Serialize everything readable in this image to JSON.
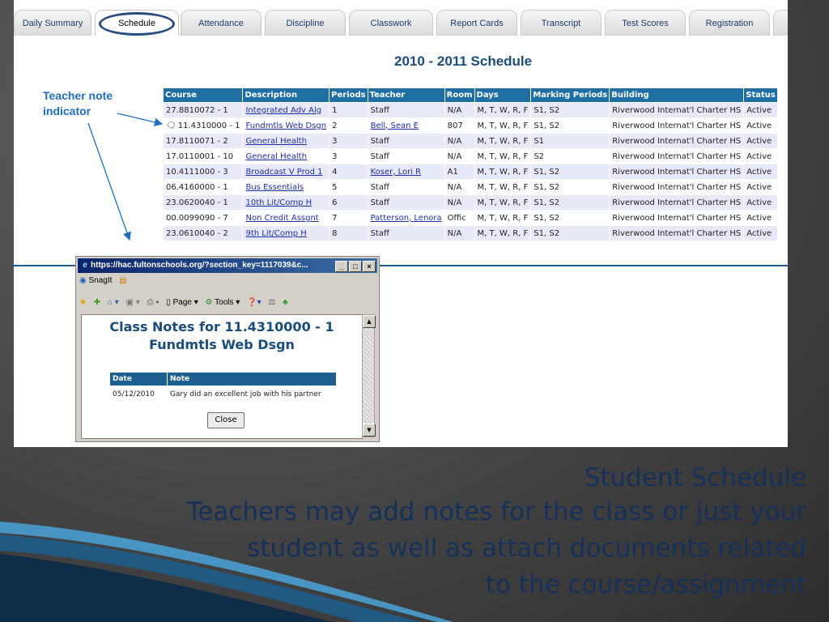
{
  "tabs": [
    "Daily Summary",
    "Schedule",
    "Attendance",
    "Discipline",
    "Classwork",
    "Report Cards",
    "Transcript",
    "Test Scores",
    "Registration"
  ],
  "active_tab": "Schedule",
  "schedule_title": "2010 - 2011 Schedule",
  "annotation_label": "Teacher note indicator",
  "table": {
    "headers": [
      "Course",
      "Description",
      "Periods",
      "Teacher",
      "Room",
      "Days",
      "Marking Periods",
      "Building",
      "Status"
    ],
    "rows": [
      [
        "27.8810072 - 1",
        "Integrated Adv Alg",
        "1",
        "Staff",
        "N/A",
        "M, T, W, R, F",
        "S1, S2",
        "Riverwood Internat'l Charter HS",
        "Active"
      ],
      [
        "11.4310000 - 1",
        "Fundmtls Web Dsgn",
        "2",
        "Bell, Sean E",
        "807",
        "M, T, W, R, F",
        "S1, S2",
        "Riverwood Internat'l Charter HS",
        "Active"
      ],
      [
        "17.8110071 - 2",
        "General Health",
        "3",
        "Staff",
        "N/A",
        "M, T, W, R, F",
        "S1",
        "Riverwood Internat'l Charter HS",
        "Active"
      ],
      [
        "17.0110001 - 10",
        "General Health",
        "3",
        "Staff",
        "N/A",
        "M, T, W, R, F",
        "S2",
        "Riverwood Internat'l Charter HS",
        "Active"
      ],
      [
        "10.4111000 - 3",
        "Broadcast V Prod 1",
        "4",
        "Koser, Lori R",
        "A1",
        "M, T, W, R, F",
        "S1, S2",
        "Riverwood Internat'l Charter HS",
        "Active"
      ],
      [
        "06.4160000 - 1",
        "Bus Essentials",
        "5",
        "Staff",
        "N/A",
        "M, T, W, R, F",
        "S1, S2",
        "Riverwood Internat'l Charter HS",
        "Active"
      ],
      [
        "23.0620040 - 1",
        "10th Lit/Comp H",
        "6",
        "Staff",
        "N/A",
        "M, T, W, R, F",
        "S1, S2",
        "Riverwood Internat'l Charter HS",
        "Active"
      ],
      [
        "00.0099090 - 7",
        "Non Credit Assgnt",
        "7",
        "Patterson, Lenora",
        "Offic",
        "M, T, W, R, F",
        "S1, S2",
        "Riverwood Internat'l Charter HS",
        "Active"
      ],
      [
        "23.0610040 - 2",
        "9th Lit/Comp H",
        "8",
        "Staff",
        "N/A",
        "M, T, W, R, F",
        "S1, S2",
        "Riverwood Internat'l Charter HS",
        "Active"
      ]
    ],
    "note_row_index": 1,
    "linked_teacher_rows": [
      1,
      4,
      7
    ]
  },
  "popup": {
    "url": "https://hac.fultonschools.org/?section_key=1117039&c...",
    "toolbar1": [
      "SnagIt"
    ],
    "toolbar2": [
      "Page",
      "Tools"
    ],
    "notes_title_line1": "Class Notes for 11.4310000 - 1",
    "notes_title_line2": "Fundmtls Web Dsgn",
    "notes_headers": [
      "Date",
      "Note"
    ],
    "notes_rows": [
      [
        "05/12/2010",
        "Gary did an excellent job with his partner"
      ]
    ],
    "close_label": "Close"
  },
  "caption": {
    "title": "Student Schedule",
    "line1": "Teachers may add notes for the class or just your",
    "line2": "student as well as attach documents related",
    "line3": "to the course/assignment"
  },
  "colors": {
    "header_blue": "#1f6fa3",
    "title_blue": "#1a4d7a",
    "annotation_blue": "#1f6fbf",
    "caption_navy": "#15305a"
  }
}
